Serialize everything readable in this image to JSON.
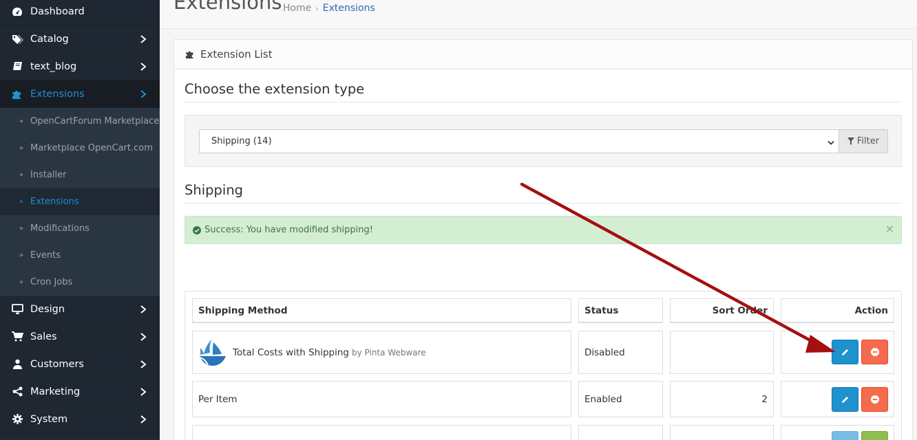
{
  "sidebar": {
    "items": [
      {
        "label": "Dashboard",
        "icon": "dashboard-icon",
        "has_children": false
      },
      {
        "label": "Catalog",
        "icon": "tags-icon",
        "has_children": true
      },
      {
        "label": "text_blog",
        "icon": "book-icon",
        "has_children": true
      },
      {
        "label": "Extensions",
        "icon": "puzzle-icon",
        "has_children": true,
        "active": true
      },
      {
        "label": "Design",
        "icon": "monitor-icon",
        "has_children": true
      },
      {
        "label": "Sales",
        "icon": "cart-icon",
        "has_children": true
      },
      {
        "label": "Customers",
        "icon": "user-icon",
        "has_children": true
      },
      {
        "label": "Marketing",
        "icon": "share-icon",
        "has_children": true
      },
      {
        "label": "System",
        "icon": "gear-icon",
        "has_children": true
      }
    ],
    "extensions_submenu": [
      {
        "label": "OpenCartForum Marketplace"
      },
      {
        "label": "Marketplace OpenCart.com"
      },
      {
        "label": "Installer"
      },
      {
        "label": "Extensions",
        "active": true
      },
      {
        "label": "Modifications"
      },
      {
        "label": "Events"
      },
      {
        "label": "Cron Jobs"
      }
    ]
  },
  "header": {
    "title": "Extensions",
    "breadcrumb": [
      "Home",
      "Extensions"
    ]
  },
  "panel": {
    "heading": "Extension List",
    "choose_title": "Choose the extension type",
    "type_select_value": "Shipping (14)",
    "filter_label": "Filter",
    "section_title": "Shipping",
    "alert": "Success: You have modified shipping!",
    "alert_close": "×"
  },
  "table": {
    "headers": [
      "Shipping Method",
      "Status",
      "Sort Order",
      "Action"
    ],
    "rows": [
      {
        "name": "Total Costs with Shipping",
        "by": "by Pinta Webware",
        "status": "Disabled",
        "sort_order": "",
        "has_logo": true
      },
      {
        "name": "Per Item",
        "by": "",
        "status": "Enabled",
        "sort_order": "2",
        "has_logo": false
      },
      {
        "name": "",
        "by": "",
        "status": "",
        "sort_order": "",
        "has_logo": false
      }
    ]
  },
  "colors": {
    "sidebar_bg": "#1e2732",
    "accent": "#1e91cf",
    "danger": "#f56b4d",
    "success_bg": "#d4eed4",
    "annotation_arrow": "#a50f0f"
  }
}
